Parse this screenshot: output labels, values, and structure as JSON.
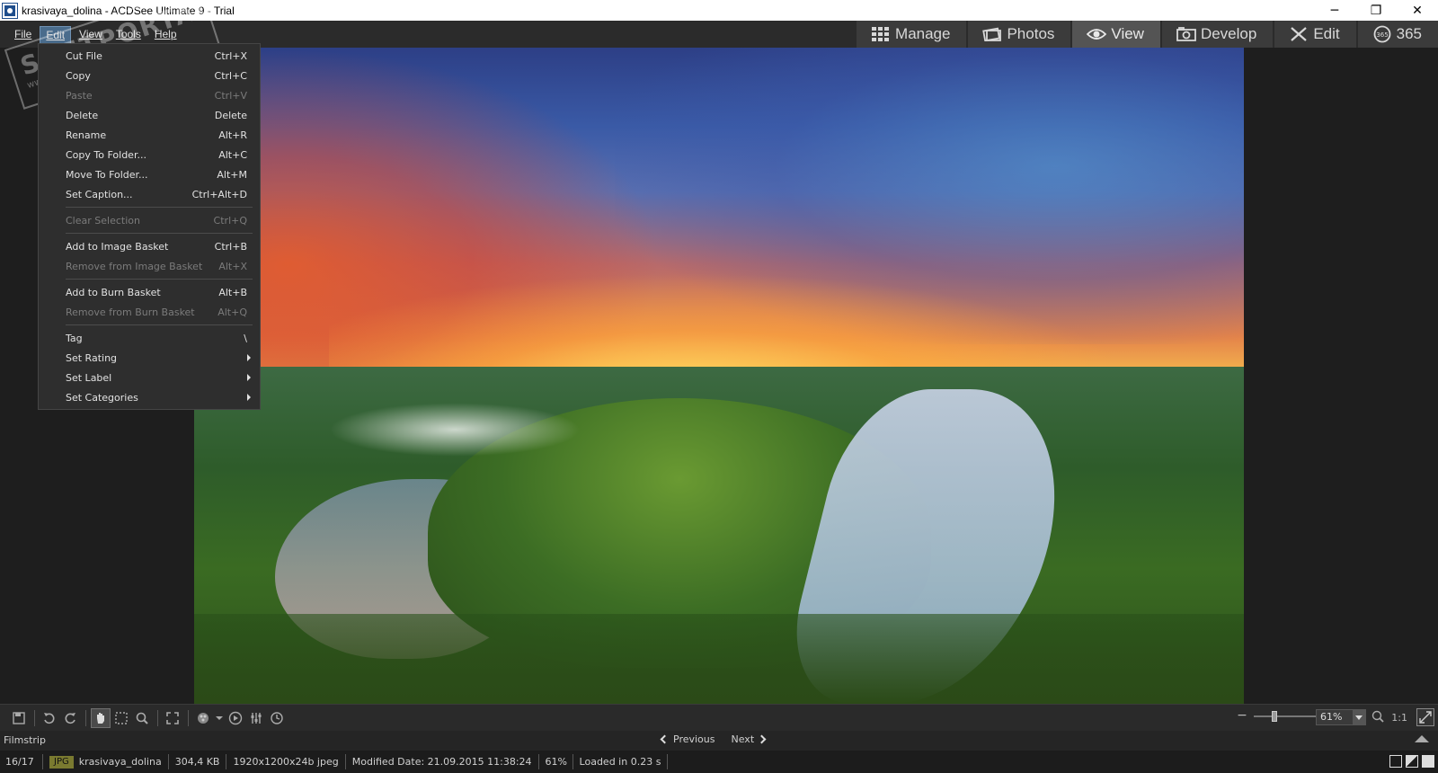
{
  "window": {
    "title": "krasivaya_dolina - ACDSee Ultimate 9 - Trial",
    "controls": [
      "─",
      "❐",
      "✕"
    ]
  },
  "watermark": {
    "text": "SOFTPORTAL",
    "subtext": "www.softportal.com"
  },
  "menubar": {
    "items": [
      {
        "label": "File"
      },
      {
        "label": "Edit"
      },
      {
        "label": "View"
      },
      {
        "label": "Tools"
      },
      {
        "label": "Help"
      }
    ],
    "active": "Edit"
  },
  "modes": [
    {
      "label": "Manage",
      "icon": "grid-icon"
    },
    {
      "label": "Photos",
      "icon": "photos-icon"
    },
    {
      "label": "View",
      "icon": "eye-icon",
      "active": true
    },
    {
      "label": "Develop",
      "icon": "develop-icon"
    },
    {
      "label": "Edit",
      "icon": "brush-icon"
    },
    {
      "label": "365",
      "icon": "365-icon"
    }
  ],
  "edit_menu": {
    "items": [
      {
        "label": "Cut File",
        "shortcut": "Ctrl+X"
      },
      {
        "label": "Copy",
        "shortcut": "Ctrl+C"
      },
      {
        "label": "Paste",
        "shortcut": "Ctrl+V",
        "disabled": true
      },
      {
        "label": "Delete",
        "shortcut": "Delete"
      },
      {
        "label": "Rename",
        "shortcut": "Alt+R"
      },
      {
        "label": "Copy To Folder...",
        "shortcut": "Alt+C"
      },
      {
        "label": "Move To Folder...",
        "shortcut": "Alt+M"
      },
      {
        "label": "Set Caption...",
        "shortcut": "Ctrl+Alt+D"
      },
      {
        "label": "Clear Selection",
        "shortcut": "Ctrl+Q",
        "disabled": true
      },
      {
        "label": "Add to Image Basket",
        "shortcut": "Ctrl+B"
      },
      {
        "label": "Remove from Image Basket",
        "shortcut": "Alt+X",
        "disabled": true
      },
      {
        "label": "Add to Burn Basket",
        "shortcut": "Alt+B"
      },
      {
        "label": "Remove from Burn Basket",
        "shortcut": "Alt+Q",
        "disabled": true
      },
      {
        "label": "Tag",
        "shortcut": "\\"
      },
      {
        "label": "Set Rating",
        "submenu": true
      },
      {
        "label": "Set Label",
        "submenu": true
      },
      {
        "label": "Set Categories",
        "submenu": true
      }
    ]
  },
  "toolbar": {
    "zoom_value": "61%",
    "zoom_minus": "−",
    "zoom_plus": "+",
    "actual_size": "1:1"
  },
  "filmstrip": {
    "label": "Filmstrip",
    "previous": "Previous",
    "next": "Next"
  },
  "status": {
    "position": "16/17",
    "format": "JPG",
    "filename": "krasivaya_dolina",
    "size": "304,4 KB",
    "dimensions": "1920x1200x24b jpeg",
    "modified": "Modified Date: 21.09.2015 11:38:24",
    "zoom": "61%",
    "loaded": "Loaded in 0.23 s"
  }
}
